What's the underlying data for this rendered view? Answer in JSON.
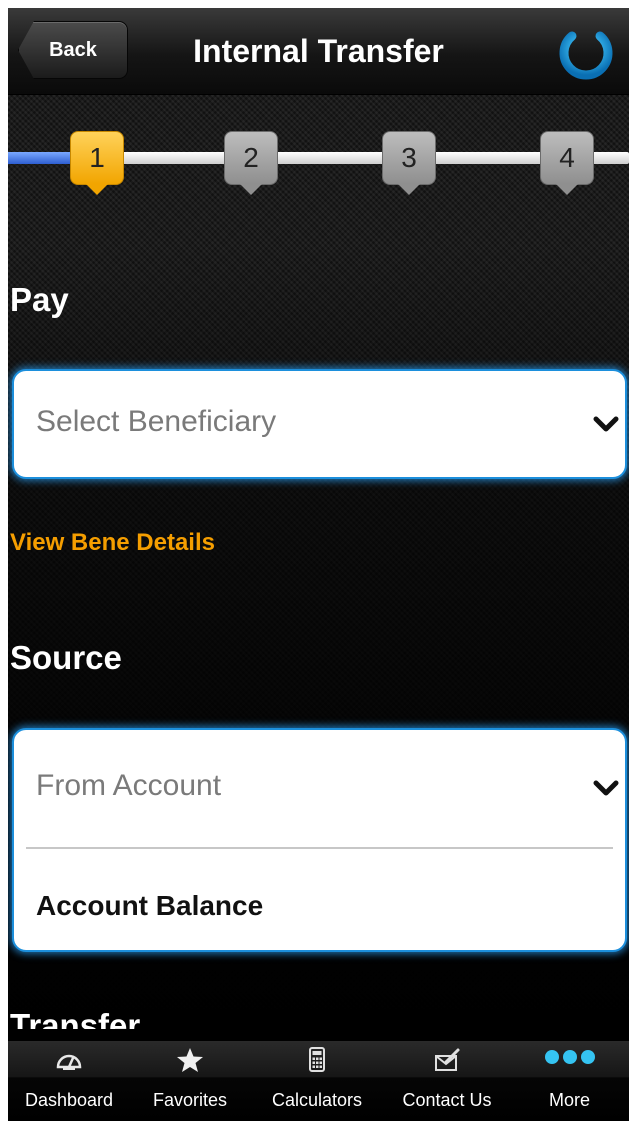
{
  "header": {
    "back_label": "Back",
    "title": "Internal Transfer",
    "power_icon": "power-icon"
  },
  "stepper": {
    "steps": [
      "1",
      "2",
      "3",
      "4"
    ],
    "active_step": 1,
    "colors": {
      "active": "#f2a500",
      "inactive": "#9e9e9e",
      "progress": "#2e5fd1"
    }
  },
  "pay": {
    "label": "Pay",
    "beneficiary_select": {
      "placeholder": "Select Beneficiary",
      "value": ""
    },
    "view_details_link": "View Bene Details"
  },
  "source": {
    "label": "Source",
    "account_select": {
      "placeholder": "From Account",
      "value": ""
    },
    "balance_label": "Account Balance"
  },
  "next_section": {
    "label": "Transfer"
  },
  "tabbar": {
    "items": [
      {
        "label": "Dashboard",
        "icon": "speedometer-icon"
      },
      {
        "label": "Favorites",
        "icon": "star-icon"
      },
      {
        "label": "Calculators",
        "icon": "calculator-icon"
      },
      {
        "label": "Contact Us",
        "icon": "envelope-edit-icon"
      },
      {
        "label": "More",
        "icon": "more-dots-icon"
      }
    ]
  },
  "colors": {
    "accent_orange": "#f59e00",
    "focus_blue": "#1c8fdc",
    "more_dots": "#35c4f2"
  }
}
